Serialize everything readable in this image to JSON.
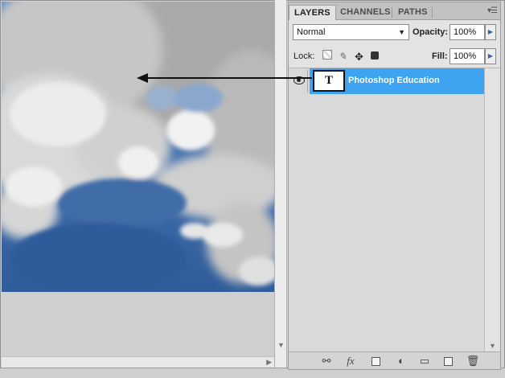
{
  "panel": {
    "tabs": [
      {
        "label": "LAYERS",
        "active": true
      },
      {
        "label": "CHANNELS",
        "active": false
      },
      {
        "label": "PATHS",
        "active": false
      }
    ],
    "menu_icon": "panel-menu-icon",
    "blend_mode": "Normal",
    "opacity_label": "Opacity:",
    "opacity_value": "100%",
    "lock_label": "Lock:",
    "fill_label": "Fill:",
    "fill_value": "100%",
    "lock_icons": [
      "lock-transparent-icon",
      "lock-image-icon",
      "lock-position-icon",
      "lock-all-icon"
    ],
    "layers": [
      {
        "name": "Photoshop Education",
        "type": "text",
        "thumb_glyph": "T",
        "visible": true,
        "selected": true
      }
    ],
    "footer_icons": [
      "link-layers-icon",
      "fx-icon",
      "layer-mask-icon",
      "adjustment-layer-icon",
      "new-group-icon",
      "new-layer-icon",
      "trash-icon"
    ],
    "fx_label": "fx",
    "selection_color": "#3ea3f0"
  },
  "canvas": {
    "sky_color": "#3d6aa8",
    "cloud_color": "#e4e4e4"
  }
}
